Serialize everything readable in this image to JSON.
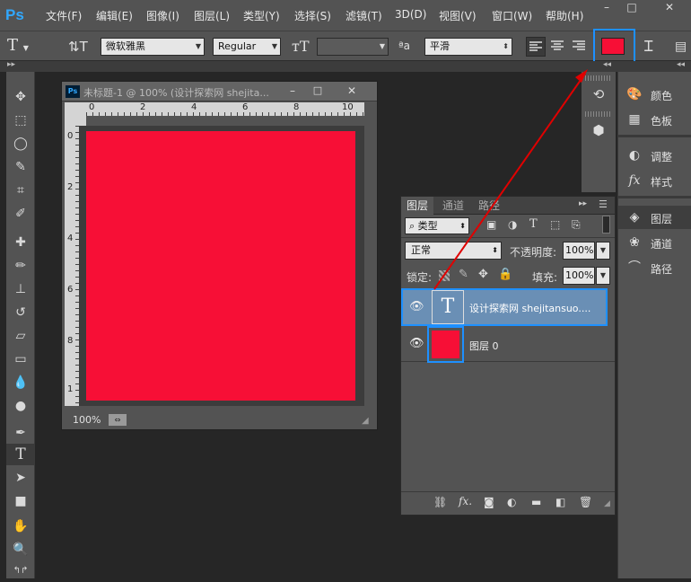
{
  "app": {
    "logo": "Ps"
  },
  "menubar": {
    "items": [
      "文件(F)",
      "编辑(E)",
      "图像(I)",
      "图层(L)",
      "类型(Y)",
      "选择(S)",
      "滤镜(T)",
      "3D(D)",
      "视图(V)",
      "窗口(W)",
      "帮助(H)"
    ],
    "window_buttons": [
      "–",
      "□",
      "✕"
    ]
  },
  "options_bar": {
    "font_family": "微软雅黑",
    "font_style": "Regular",
    "font_size": "",
    "aa_label": "ªa",
    "antialias": "平滑",
    "text_color": "#f70f36"
  },
  "document": {
    "title": "未标题-1 @ 100% (设计探索网 shejita...",
    "ruler_top_labels": [
      "0",
      "2",
      "4",
      "6",
      "8",
      "10"
    ],
    "ruler_left_labels": [
      "0",
      "2",
      "4",
      "6",
      "8",
      "1"
    ],
    "zoom": "100%",
    "canvas_color": "#f70f36"
  },
  "layers_panel": {
    "tabs": [
      "图层",
      "通道",
      "路径"
    ],
    "filter_kind": "类型",
    "blend_mode": "正常",
    "opacity_label": "不透明度:",
    "opacity_value": "100%",
    "lock_label": "锁定:",
    "fill_label": "填充:",
    "fill_value": "100%",
    "layers": [
      {
        "name": "设计探索网 shejitansuo....",
        "type": "text",
        "thumb": "T",
        "selected": true
      },
      {
        "name": "图层 0",
        "type": "pixel",
        "thumb_color": "#f70f36",
        "selected": false
      }
    ]
  },
  "right_dock": {
    "items": [
      "颜色",
      "色板",
      "调整",
      "样式",
      "图层",
      "通道",
      "路径"
    ]
  },
  "highlight_color": "#1e90ff",
  "arrow_color": "#e00000"
}
